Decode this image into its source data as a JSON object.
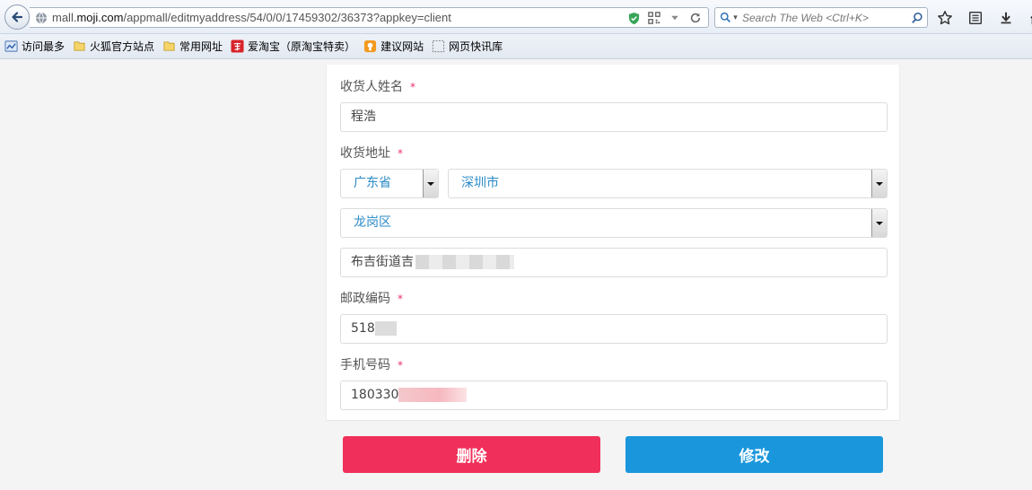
{
  "browser": {
    "url_prefix": "mall.",
    "url_domain": "moji.com",
    "url_path": "/appmall/editmyaddress/54/0/0/17459302/36373?appkey=client",
    "search_placeholder": "Search The Web <Ctrl+K>",
    "bookmarks": [
      {
        "label": "访问最多",
        "icon": "most-visited-icon"
      },
      {
        "label": "火狐官方站点",
        "icon": "folder-icon"
      },
      {
        "label": "常用网址",
        "icon": "folder-icon"
      },
      {
        "label": "爱淘宝（原淘宝特卖）",
        "icon": "taobao-icon"
      },
      {
        "label": "建议网站",
        "icon": "suggested-sites-icon"
      },
      {
        "label": "网页快讯库",
        "icon": "web-slice-icon"
      }
    ]
  },
  "form": {
    "name_label": "收货人姓名",
    "name_value": "程浩",
    "address_label": "收货地址",
    "province": "广东省",
    "city": "深圳市",
    "district": "龙岗区",
    "street_value": "布吉街道吉",
    "zip_label": "邮政编码",
    "zip_value": "518",
    "phone_label": "手机号码",
    "phone_value": "180330",
    "required_mark": "*"
  },
  "actions": {
    "delete_label": "删除",
    "modify_label": "修改"
  },
  "colors": {
    "required": "#e8336b",
    "select_text": "#2a8bc7",
    "delete_button": "#f0305a",
    "modify_button": "#1a97dc"
  }
}
